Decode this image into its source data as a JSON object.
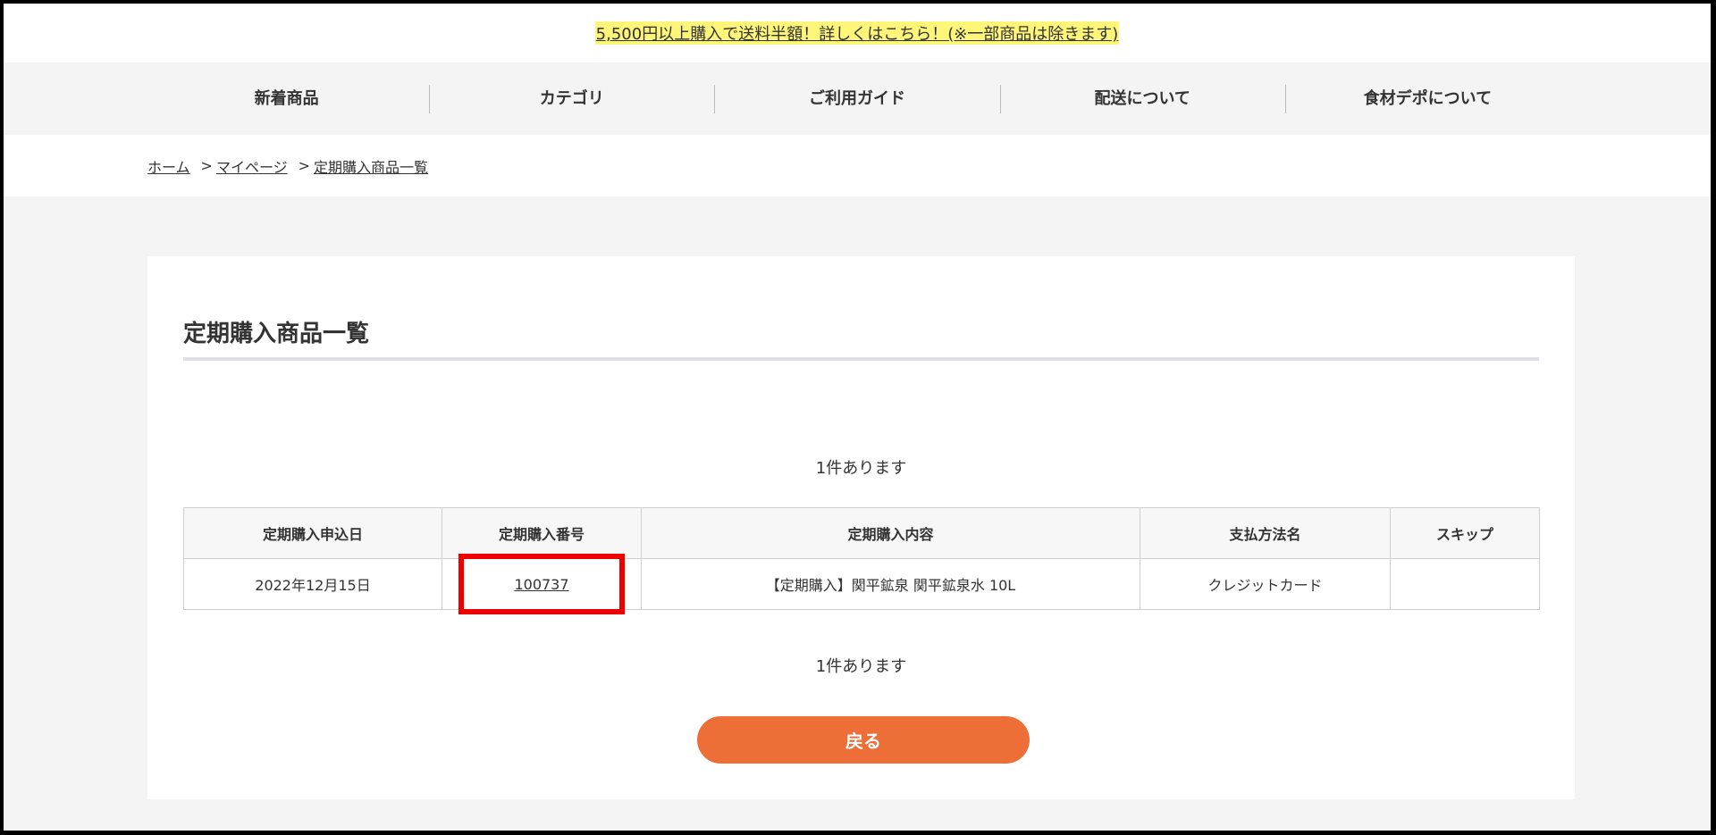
{
  "announcement": {
    "text": "5,500円以上購入で送料半額！詳しくはこちら！(※一部商品は除きます)"
  },
  "nav": {
    "items": [
      {
        "label": "新着商品"
      },
      {
        "label": "カテゴリ"
      },
      {
        "label": "ご利用ガイド"
      },
      {
        "label": "配送について"
      },
      {
        "label": "食材デポについて"
      }
    ]
  },
  "breadcrumb": {
    "home": "ホーム",
    "mypage": "マイページ",
    "current": "定期購入商品一覧",
    "separator": ">"
  },
  "main": {
    "title": "定期購入商品一覧",
    "count_text": "1件あります",
    "table": {
      "headers": [
        "定期購入申込日",
        "定期購入番号",
        "定期購入内容",
        "支払方法名",
        "スキップ"
      ],
      "rows": [
        {
          "date": "2022年12月15日",
          "number": "100737",
          "content": "【定期購入】関平鉱泉 関平鉱泉水 10L",
          "payment": "クレジットカード",
          "skip": ""
        }
      ]
    },
    "back_label": "戻る"
  },
  "colors": {
    "accent_button": "#ee6e38",
    "highlight_box": "#ee0000",
    "announcement_highlight": "#fff578"
  }
}
